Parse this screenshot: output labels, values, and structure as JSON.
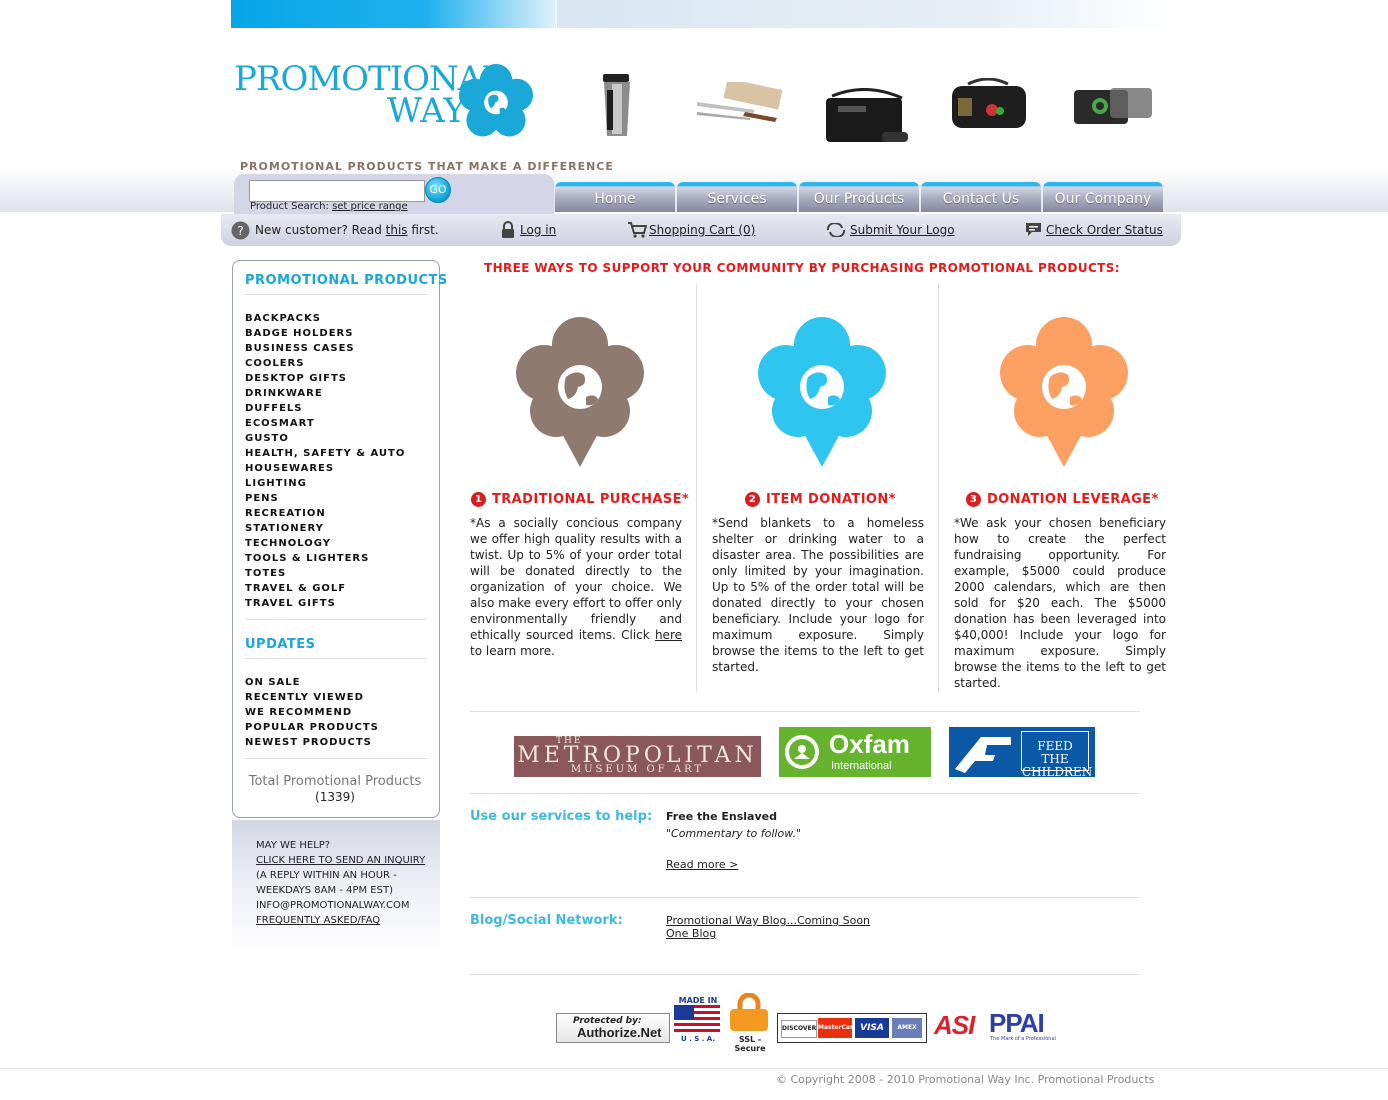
{
  "brand": {
    "logo_line1": "PROMOTIONAL",
    "logo_line2": "WAY",
    "tagline": "PROMOTIONAL PRODUCTS THAT MAKE A DIFFERENCE",
    "accent_color": "#1aa8d8"
  },
  "search": {
    "value": "",
    "go_label": "GO",
    "label": "Product Search:",
    "price_link": "set price range"
  },
  "nav": {
    "tabs": [
      "Home",
      "Services",
      "Our Products",
      "Contact Us",
      "Our Company"
    ]
  },
  "util": {
    "new_customer_prefix": "New customer? Read ",
    "new_customer_link": "this",
    "new_customer_suffix": " first.",
    "login": "Log in",
    "cart": "Shopping Cart (0)",
    "submit_logo": "Submit Your Logo",
    "order_status": "Check Order Status"
  },
  "sidebar": {
    "heading": "PROMOTIONAL PRODUCTS",
    "categories": [
      "BACKPACKS",
      "BADGE HOLDERS",
      "BUSINESS CASES",
      "COOLERS",
      "DESKTOP GIFTS",
      "DRINKWARE",
      "DUFFELS",
      "ECOSMART",
      "GUSTO",
      "HEALTH, SAFETY & AUTO",
      "HOUSEWARES",
      "LIGHTING",
      "PENS",
      "RECREATION",
      "STATIONERY",
      "TECHNOLOGY",
      "TOOLS & LIGHTERS",
      "TOTES",
      "TRAVEL & GOLF",
      "TRAVEL GIFTS"
    ],
    "updates_heading": "UPDATES",
    "updates": [
      "ON SALE",
      "RECENTLY VIEWED",
      "WE RECOMMEND",
      "POPULAR PRODUCTS",
      "NEWEST PRODUCTS"
    ],
    "total_label": "Total Promotional Products",
    "total_count": "(1339)"
  },
  "help": {
    "title": "MAY WE HELP?",
    "inquiry_link": "CLICK HERE TO SEND AN INQUIRY",
    "reply_line1": "(A REPLY WITHIN AN HOUR -",
    "reply_line2": "WEEKDAYS 8AM - 4PM EST)",
    "email": "INFO@PROMOTIONALWAY.COM",
    "faq_link": "FREQUENTLY ASKED/FAQ"
  },
  "main": {
    "headline": "THREE WAYS TO SUPPORT YOUR COMMUNITY BY PURCHASING PROMOTIONAL PRODUCTS:",
    "columns": [
      {
        "num": "1",
        "title": "TRADITIONAL PURCHASE*",
        "color": "#8e7a6e",
        "text_before": "*As a socially concious company we offer high quality results with a twist. Up to 5% of your order total will be donated directly to the organization of your choice. We also make every effort to offer only environmentally friendly and ethically sourced items. Click ",
        "link": "here",
        "text_after": " to learn more."
      },
      {
        "num": "2",
        "title": "ITEM DONATION*",
        "color": "#2ec5ee",
        "text": "*Send blankets to a homeless shelter or drinking water to a disaster area. The possibilities are only limited by your imagination. Up to 5% of the order total will be donated directly to your chosen beneficiary. Include your logo for maximum exposure. Simply browse the items to the left to get started."
      },
      {
        "num": "3",
        "title": "DONATION LEVERAGE*",
        "color": "#fba062",
        "text": "*We ask your chosen beneficiary how to create the perfect fundraising opportunity. For example, $5000 could produce 2000 calendars, which are then sold for $20 each. The $5000 donation has been leveraged into $40,000! Include your logo for maximum exposure. Simply browse the items to the left to get started."
      }
    ],
    "partners": {
      "met_small": "THE",
      "met_main": "METROPOLITAN",
      "met_sub": "MUSEUM OF ART",
      "oxfam_main": "Oxfam",
      "oxfam_sub": "International",
      "ftc_line1": "FEED THE",
      "ftc_line2": "CHILDREN"
    },
    "services": {
      "label": "Use our services to help:",
      "title": "Free the Enslaved",
      "comment": "\"Commentary to follow.\"",
      "read_more": "Read more >"
    },
    "blog": {
      "label": "Blog/Social Network:",
      "link1": "Promotional Way Blog...Coming Soon",
      "link2": "One Blog"
    }
  },
  "badges": {
    "authorize_top": "Protected by:",
    "authorize_main": "Authorize.Net",
    "usa_top": "MADE IN",
    "usa_bottom": "U . S . A.",
    "ssl": "SSL - Secure",
    "card1": "DISCOVER",
    "card2": "MasterCard",
    "card3": "VISA",
    "card4": "AMEX",
    "asi": "ASI",
    "ppai": "PPAI",
    "ppai_sub": "The Mark of a Professional"
  },
  "footer": {
    "copyright": "© Copyright 2008 - 2010 Promotional Way Inc. Promotional Products"
  }
}
